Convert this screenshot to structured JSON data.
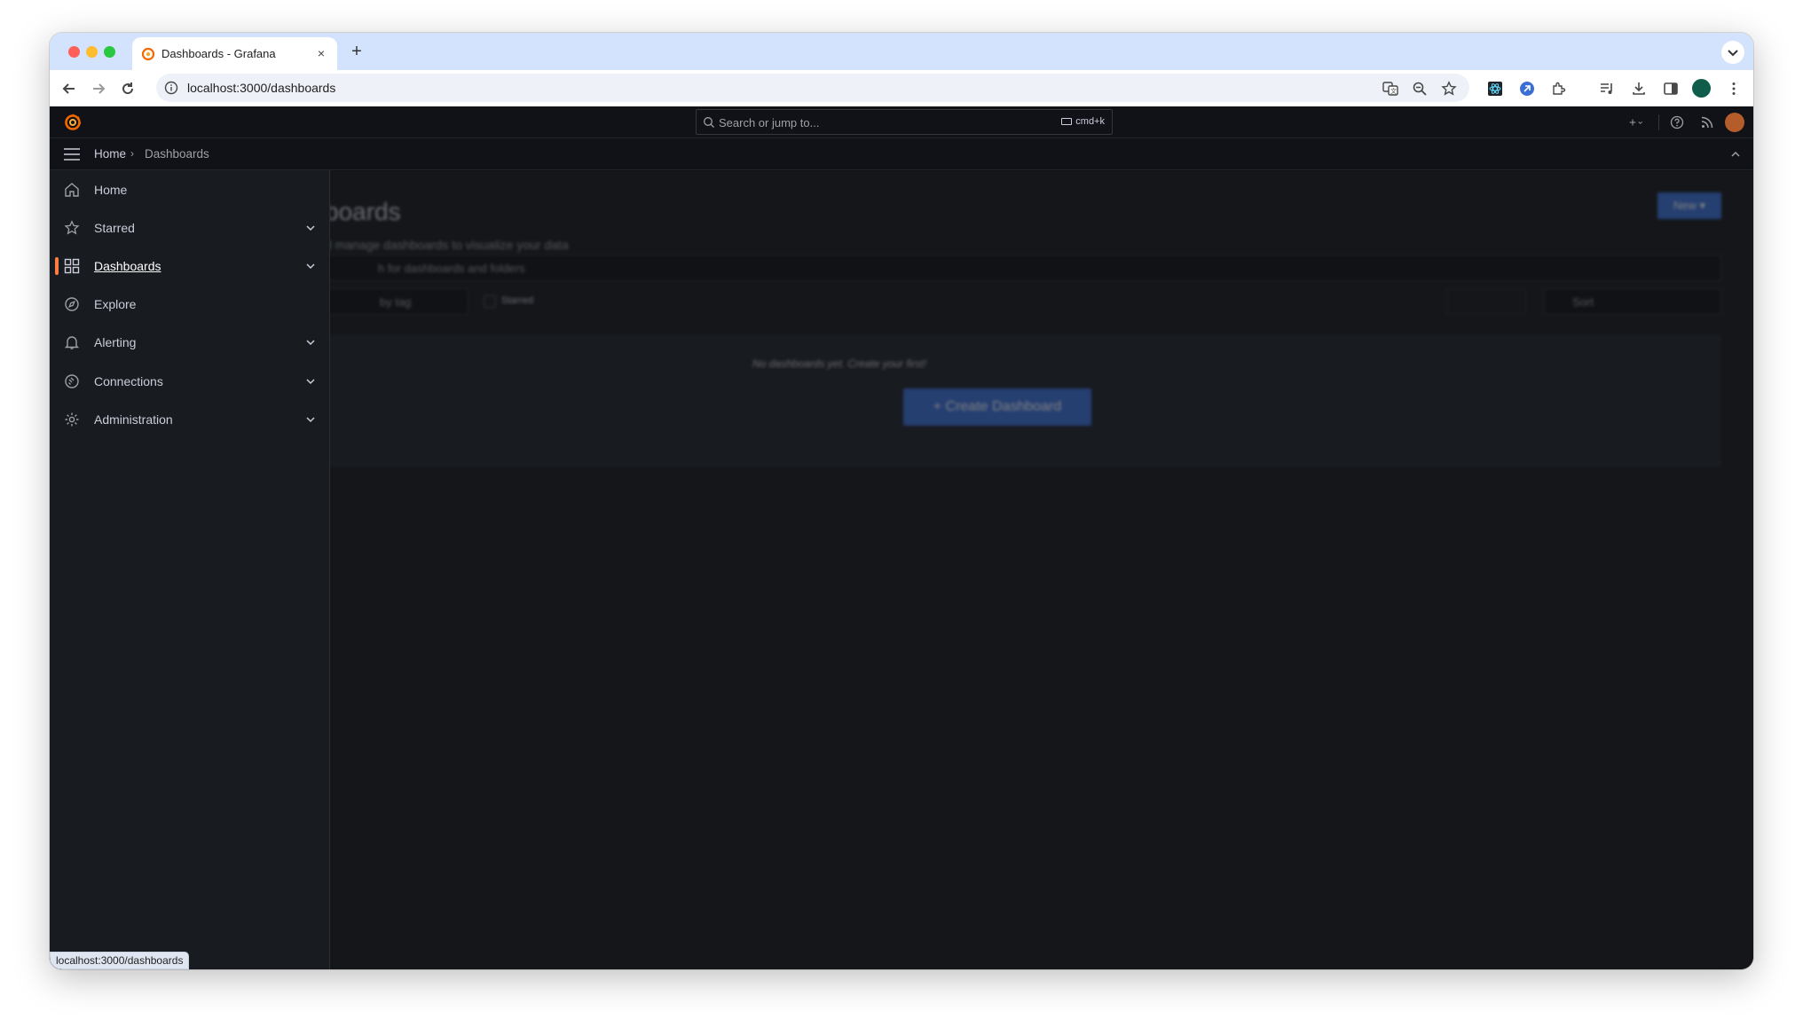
{
  "browser": {
    "tab_title": "Dashboards - Grafana",
    "tab_close": "×",
    "new_tab": "+",
    "url": "localhost:3000/dashboards",
    "status_url": "localhost:3000/dashboards"
  },
  "grafana": {
    "search_placeholder": "Search or jump to...",
    "search_shortcut": "cmd+k",
    "breadcrumb": {
      "home": "Home",
      "separator": "›",
      "current": "Dashboards"
    },
    "page": {
      "title": "boards",
      "subtitle": "d manage dashboards to visualize your data",
      "new_button": "New ▾",
      "search_placeholder": "h for dashboards and folders",
      "tag_filter": "by tag",
      "starred_label": "Starred",
      "sort_label": "Sort",
      "empty_message": "No dashboards yet. Create your first!",
      "create_button": "+   Create Dashboard"
    },
    "sidebar": {
      "items": [
        {
          "label": "Home",
          "icon": "home-icon",
          "expandable": false,
          "active": false
        },
        {
          "label": "Starred",
          "icon": "star-icon",
          "expandable": true,
          "active": false
        },
        {
          "label": "Dashboards",
          "icon": "apps-icon",
          "expandable": true,
          "active": true
        },
        {
          "label": "Explore",
          "icon": "compass-icon",
          "expandable": false,
          "active": false
        },
        {
          "label": "Alerting",
          "icon": "bell-icon",
          "expandable": true,
          "active": false
        },
        {
          "label": "Connections",
          "icon": "plug-icon",
          "expandable": true,
          "active": false
        },
        {
          "label": "Administration",
          "icon": "cog-icon",
          "expandable": true,
          "active": false
        }
      ]
    },
    "colors": {
      "accent": "#ff7d40",
      "primary_button": "#3d71d9",
      "background": "#111217",
      "panel": "#181b1f"
    }
  }
}
